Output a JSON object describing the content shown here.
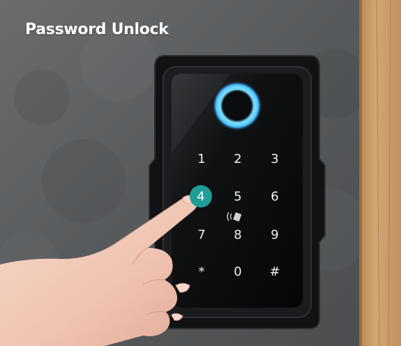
{
  "title": "Password Unlock",
  "keypad": {
    "keys": [
      "1",
      "2",
      "3",
      "4",
      "5",
      "6",
      "7",
      "8",
      "9",
      "*",
      "0",
      "#"
    ],
    "active_key": "4"
  },
  "colors": {
    "active_key_bg": "#1f9e98",
    "ring_glow": "#5fd4ff",
    "wall": "#5b5d5f",
    "wood": "#c79a65"
  },
  "icons": [
    "fingerprint-ring-icon",
    "nfc-card-icon"
  ]
}
